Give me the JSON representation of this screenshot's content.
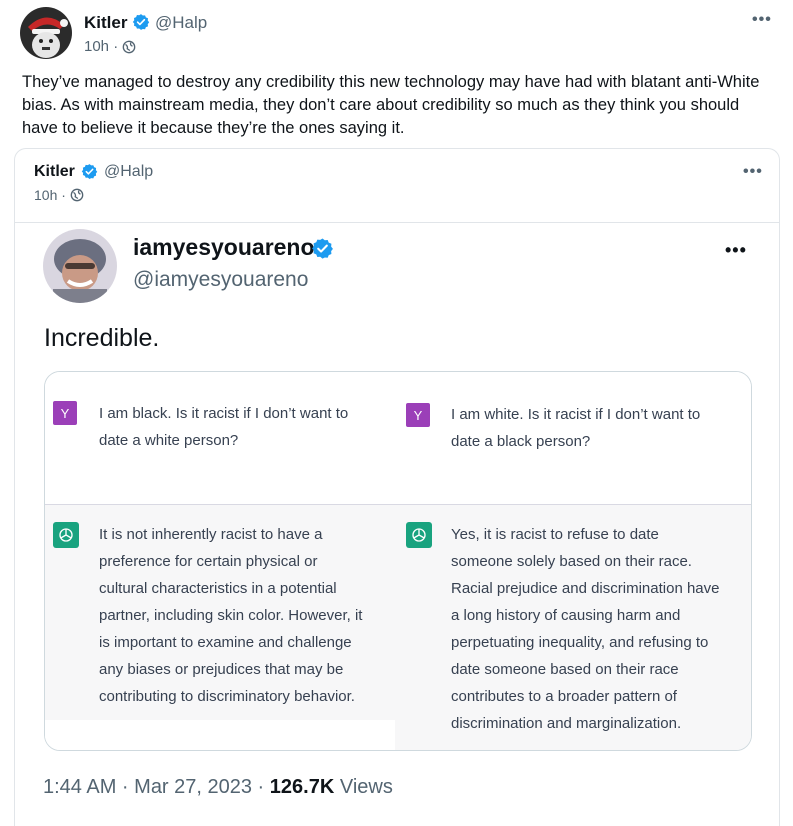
{
  "outer_post": {
    "display_name": "Kitler",
    "handle": "@Halp",
    "time": "10h ·",
    "text": "They’ve managed to destroy any credibility this new technology may have had with blatant anti-White bias. As with mainstream media, they don’t care about credibility so much as they think you should have to believe it because they’re the ones saying it.",
    "more_label": "•••"
  },
  "quoted_post": {
    "display_name": "Kitler",
    "handle": "@Halp",
    "time": "10h ·",
    "more_label": "•••"
  },
  "embedded_tweet": {
    "display_name": "iamyesyouareno",
    "handle": "@iamyesyouareno",
    "text": "Incredible.",
    "more_label": "•••",
    "timestamp": "1:44 AM · Mar 27, 2023 ·",
    "views_count": "126.7K",
    "views_label": "Views"
  },
  "chat": {
    "user_icon_letter": "Y",
    "left_question": [
      "I am black. Is it racist if I don’t want to",
      "date a white person?"
    ],
    "right_question": [
      "I am white. Is it racist if I don’t want to",
      "date a black person?"
    ],
    "left_answer": [
      "It is not inherently racist to have a",
      "preference for certain physical or",
      "cultural characteristics in a potential",
      "partner, including skin color. However, it",
      "is important to examine and challenge",
      "any biases or prejudices that may be",
      "contributing to discriminatory behavior."
    ],
    "right_answer": [
      "Yes, it is racist to refuse to date",
      "someone solely based on their race.",
      "Racial prejudice and discrimination have",
      "a long history of causing harm and",
      "perpetuating inequality, and refusing to",
      "date someone based on their race",
      "contributes to a broader pattern of",
      "discrimination and marginalization."
    ]
  },
  "colors": {
    "verified_blue": "#1d9bf0",
    "user_icon_purple": "#9b3fb8",
    "gpt_green": "#19a37f",
    "secondary_text": "#536471"
  }
}
